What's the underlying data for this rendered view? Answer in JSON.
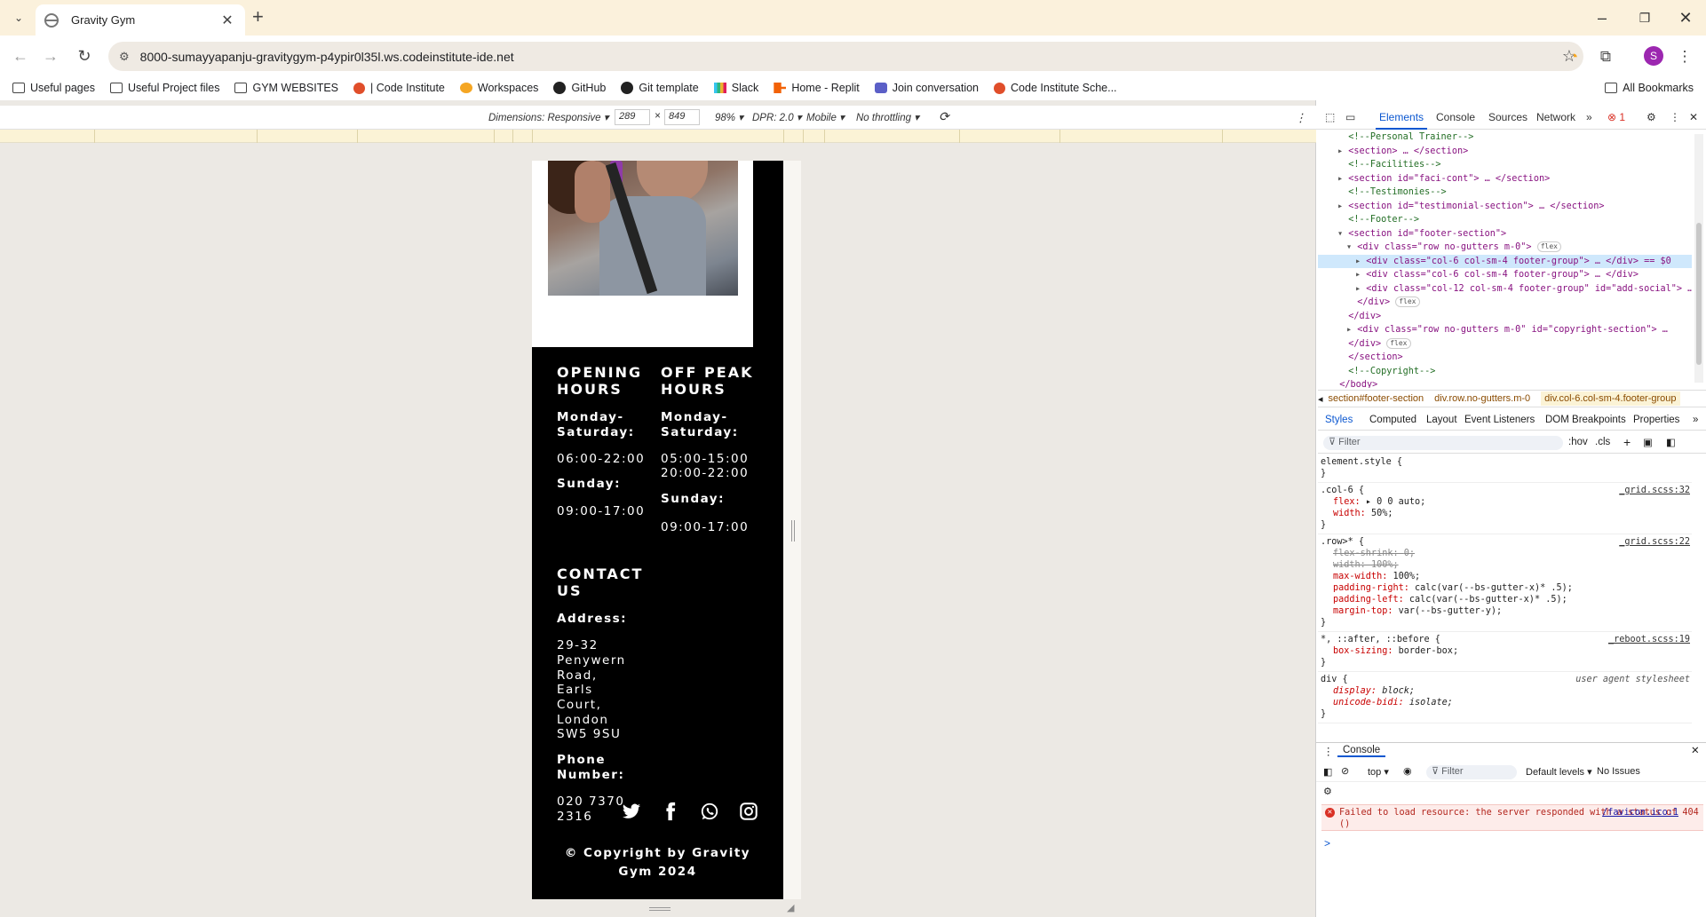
{
  "browser": {
    "tab_title": "Gravity Gym",
    "url": "8000-sumayyapanju-gravitygym-p4ypir0l35l.ws.codeinstitute-ide.net",
    "bookmarks": [
      "Useful pages",
      "Useful Project files",
      "GYM WEBSITES",
      "| Code Institute",
      "Workspaces",
      "GitHub",
      "Git template",
      "Slack",
      "Home - Replit",
      "Join conversation",
      "Code Institute Sche..."
    ],
    "all_bookmarks": "All Bookmarks",
    "avatar": "S"
  },
  "device_toolbar": {
    "dimensions": "Dimensions: Responsive",
    "width": "289",
    "times": "×",
    "height": "849",
    "zoom": "98%",
    "dpr": "DPR: 2.0",
    "device_type": "Mobile",
    "throttling": "No throttling"
  },
  "footer": {
    "opening_heading": "OPENING HOURS",
    "off_peak_heading": "OFF PEAK HOURS",
    "opening_weekday_label": "Monday-Saturday:",
    "opening_weekday_hours": "06:00-22:00",
    "opening_sunday_label": "Sunday:",
    "opening_sunday_hours": "09:00-17:00",
    "offpeak_weekday_label": "Monday-Saturday:",
    "offpeak_weekday_hours_1": "05:00-15:00",
    "offpeak_weekday_hours_2": "20:00-22:00",
    "offpeak_sunday_label": "Sunday:",
    "offpeak_sunday_hours": "09:00-17:00",
    "contact_heading": "CONTACT US",
    "address_label": "Address:",
    "address_lines": [
      "29-32",
      "Penywern",
      "Road,",
      "Earls",
      "Court,",
      "London",
      "SW5 9SU"
    ],
    "phone_label": "Phone Number:",
    "phone_lines": [
      "020 7370",
      "2316"
    ],
    "social_icons": [
      "twitter-icon",
      "facebook-icon",
      "whatsapp-icon",
      "instagram-icon"
    ],
    "copyright_1": "© Copyright by Gravity",
    "copyright_2": "Gym 2024"
  },
  "devtools": {
    "tabs": [
      "Elements",
      "Console",
      "Sources",
      "Network"
    ],
    "error_count": "1",
    "dom_lines": [
      {
        "kind": "comment",
        "text": "<!--Personal Trainer-->"
      },
      {
        "kind": "node",
        "text": "<section> … </section>"
      },
      {
        "kind": "comment",
        "text": "<!--Facilities-->"
      },
      {
        "kind": "node",
        "text": "<section id=\"faci-cont\"> … </section>"
      },
      {
        "kind": "comment",
        "text": "<!--Testimonies-->"
      },
      {
        "kind": "node",
        "text": "<section id=\"testimonial-section\"> … </section>"
      },
      {
        "kind": "comment",
        "text": "<!--Footer-->"
      },
      {
        "kind": "node",
        "text": "<section id=\"footer-section\">"
      },
      {
        "kind": "node",
        "text": "<div class=\"row no-gutters m-0\">",
        "badge": "flex"
      },
      {
        "kind": "node",
        "text": "<div class=\"col-6 col-sm-4 footer-group\"> … </div> == $0",
        "selected": true
      },
      {
        "kind": "node",
        "text": "<div class=\"col-6 col-sm-4 footer-group\"> … </div>"
      },
      {
        "kind": "node",
        "text": "<div class=\"col-12 col-sm-4 footer-group\" id=\"add-social\"> …"
      },
      {
        "kind": "node",
        "text": "</div>",
        "badge": "flex"
      },
      {
        "kind": "node",
        "text": "</div>"
      },
      {
        "kind": "node",
        "text": "<div class=\"row no-gutters m-0\" id=\"copyright-section\"> …"
      },
      {
        "kind": "node",
        "text": "</div>",
        "badge": "flex"
      },
      {
        "kind": "node",
        "text": "</section>"
      },
      {
        "kind": "comment",
        "text": "<!--Copyright-->"
      },
      {
        "kind": "node",
        "text": "</body>"
      }
    ],
    "breadcrumbs": [
      "section#footer-section",
      "div.row.no-gutters.m-0",
      "div.col-6.col-sm-4.footer-group"
    ],
    "styles_tabs": [
      "Styles",
      "Computed",
      "Layout",
      "Event Listeners",
      "DOM Breakpoints",
      "Properties"
    ],
    "filter_placeholder": "Filter",
    "hov": ":hov",
    "cls": ".cls",
    "style_rules": [
      {
        "selector": "element.style {",
        "source": "",
        "props": [],
        "close": "}"
      },
      {
        "selector": ".col-6 {",
        "source": "_grid.scss:32",
        "props": [
          {
            "name": "flex",
            "value": "▸ 0 0 auto;"
          },
          {
            "name": "width",
            "value": "50%;"
          }
        ],
        "close": "}"
      },
      {
        "selector": ".row>* {",
        "source": "_grid.scss:22",
        "props": [
          {
            "name": "flex-shrink",
            "value": "0;",
            "strike": true
          },
          {
            "name": "width",
            "value": "100%;",
            "strike": true
          },
          {
            "name": "max-width",
            "value": "100%;"
          },
          {
            "name": "padding-right",
            "value": "calc(var(--bs-gutter-x)* .5);"
          },
          {
            "name": "padding-left",
            "value": "calc(var(--bs-gutter-x)* .5);"
          },
          {
            "name": "margin-top",
            "value": "var(--bs-gutter-y);"
          }
        ],
        "close": "}"
      },
      {
        "selector": "*, ::after, ::before {",
        "source": "_reboot.scss:19",
        "props": [
          {
            "name": "box-sizing",
            "value": "border-box;"
          }
        ],
        "close": "}"
      },
      {
        "selector": "div {",
        "source": "user agent stylesheet",
        "ua": true,
        "props": [
          {
            "name": "display",
            "value": "block;",
            "italic": true
          },
          {
            "name": "unicode-bidi",
            "value": "isolate;",
            "italic": true
          }
        ],
        "close": "}"
      }
    ],
    "console": {
      "title": "Console",
      "context": "top",
      "filter_placeholder": "Filter",
      "levels": "Default levels",
      "issues": "No Issues",
      "error_text": "Failed to load resource: the server responded with a status of 404 ()",
      "error_link": "/favicon.ico:1",
      "prompt": ">"
    }
  }
}
